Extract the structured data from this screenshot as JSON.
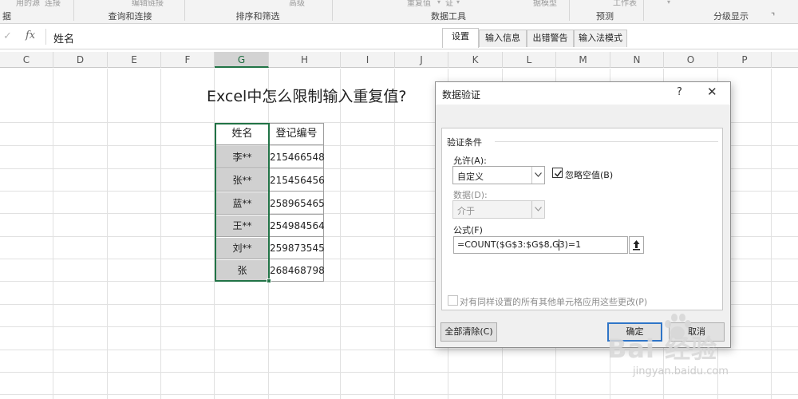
{
  "ribbon": {
    "top_cut_texts": [
      "用的源",
      "连接",
      "编辑链接",
      "高级",
      "重复值",
      "证",
      "据模型",
      "工作表"
    ],
    "groups": [
      "查询和连接",
      "排序和筛选",
      "数据工具",
      "预测",
      "分级显示"
    ],
    "left_edge_text": "据"
  },
  "formula_bar": {
    "cancel_icon": "✓",
    "fx_label": "fx",
    "content": "姓名"
  },
  "columns": [
    "C",
    "D",
    "E",
    "F",
    "G",
    "H",
    "I",
    "J",
    "K",
    "L",
    "M",
    "N",
    "O",
    "P"
  ],
  "selected_column": "G",
  "sheet": {
    "title": "Excel中怎么限制输入重复值?",
    "table": {
      "headers": [
        "姓名",
        "登记编号"
      ],
      "rows": [
        [
          "李**",
          "215466548"
        ],
        [
          "张**",
          "215456456"
        ],
        [
          "蓝**",
          "258965465"
        ],
        [
          "王**",
          "254984564"
        ],
        [
          "刘**",
          "259873545"
        ],
        [
          "张",
          "268468798"
        ]
      ]
    }
  },
  "dialog": {
    "title": "数据验证",
    "help_label": "?",
    "close_label": "✕",
    "tabs": [
      "设置",
      "输入信息",
      "出错警告",
      "输入法模式"
    ],
    "active_tab": "设置",
    "group_label": "验证条件",
    "allow_label": "允许(A):",
    "allow_value": "自定义",
    "ignore_blank_label": "忽略空值(B)",
    "ignore_blank_checked": true,
    "data_label": "数据(D):",
    "data_value": "介于",
    "formula_label": "公式(F)",
    "formula_value": "=COUNT($G$3:$G$8,G3)=1",
    "apply_all_label": "对有同样设置的所有其他单元格应用这些更改(P)",
    "apply_all_checked": false,
    "clear_all_label": "全部清除(C)",
    "ok_label": "确定",
    "cancel_label": "取消"
  },
  "watermark": {
    "brand": "Bai 经验",
    "url": "jingyan.baidu.com"
  },
  "colors": {
    "excel_green": "#217346",
    "selection_gray": "#d0d0d0",
    "default_button_border": "#2f75c7"
  }
}
